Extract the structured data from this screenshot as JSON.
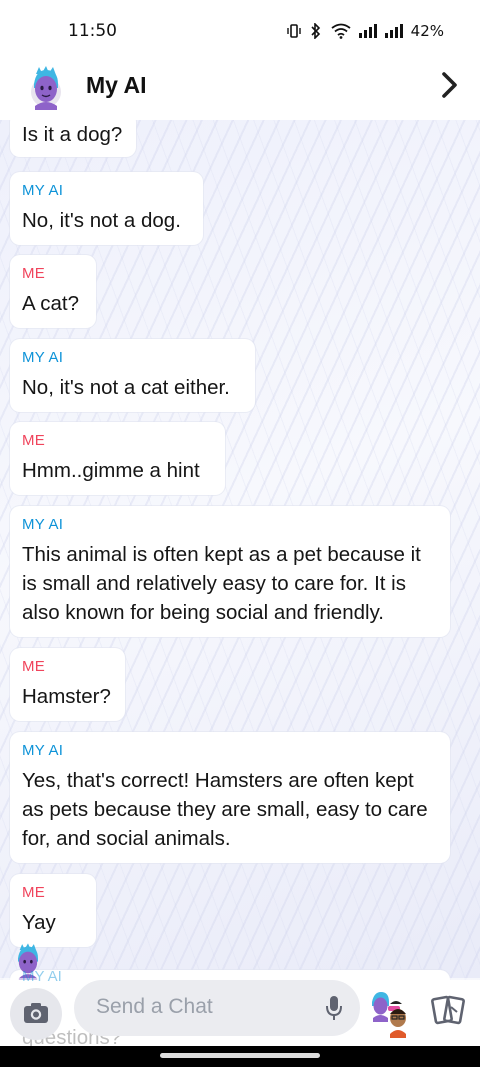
{
  "status": {
    "time": "11:50",
    "battery": "42%",
    "icons": [
      "vibrate-icon",
      "bluetooth-icon",
      "wifi-icon",
      "signal-icon",
      "signal-icon"
    ]
  },
  "header": {
    "title": "My AI",
    "avatar": "my-ai-avatar",
    "chevron": "chevron-right-icon"
  },
  "messages": [
    {
      "sender": "",
      "text": "Is it a dog?"
    },
    {
      "sender": "MY AI",
      "text": "No, it's not a dog."
    },
    {
      "sender": "ME",
      "text": "A cat?"
    },
    {
      "sender": "MY AI",
      "text": "No, it's not a cat either."
    },
    {
      "sender": "ME",
      "text": "Hmm..gimme a hint"
    },
    {
      "sender": "MY AI",
      "text": "This animal is often kept as a pet because it is small and relatively easy to care for. It is also known for being social and friendly."
    },
    {
      "sender": "ME",
      "text": "Hamster?"
    },
    {
      "sender": "MY AI",
      "text": "Yes, that's correct! Hamsters are often kept as pets because they are small, easy to care for, and social animals."
    },
    {
      "sender": "ME",
      "text": "Yay"
    }
  ],
  "partial": {
    "sender": "MY AI",
    "text": "questions?"
  },
  "composer": {
    "placeholder": "Send a Chat",
    "camera_icon": "camera-icon",
    "mic_icon": "microphone-icon",
    "bitmoji_icon": "bitmoji-icon",
    "cards_icon": "cards-icon"
  },
  "colors": {
    "my_ai_label": "#0e93d8",
    "me_label": "#f0445c",
    "avatar_hair": "#3fb6e3",
    "avatar_face": "#8e63c9"
  }
}
